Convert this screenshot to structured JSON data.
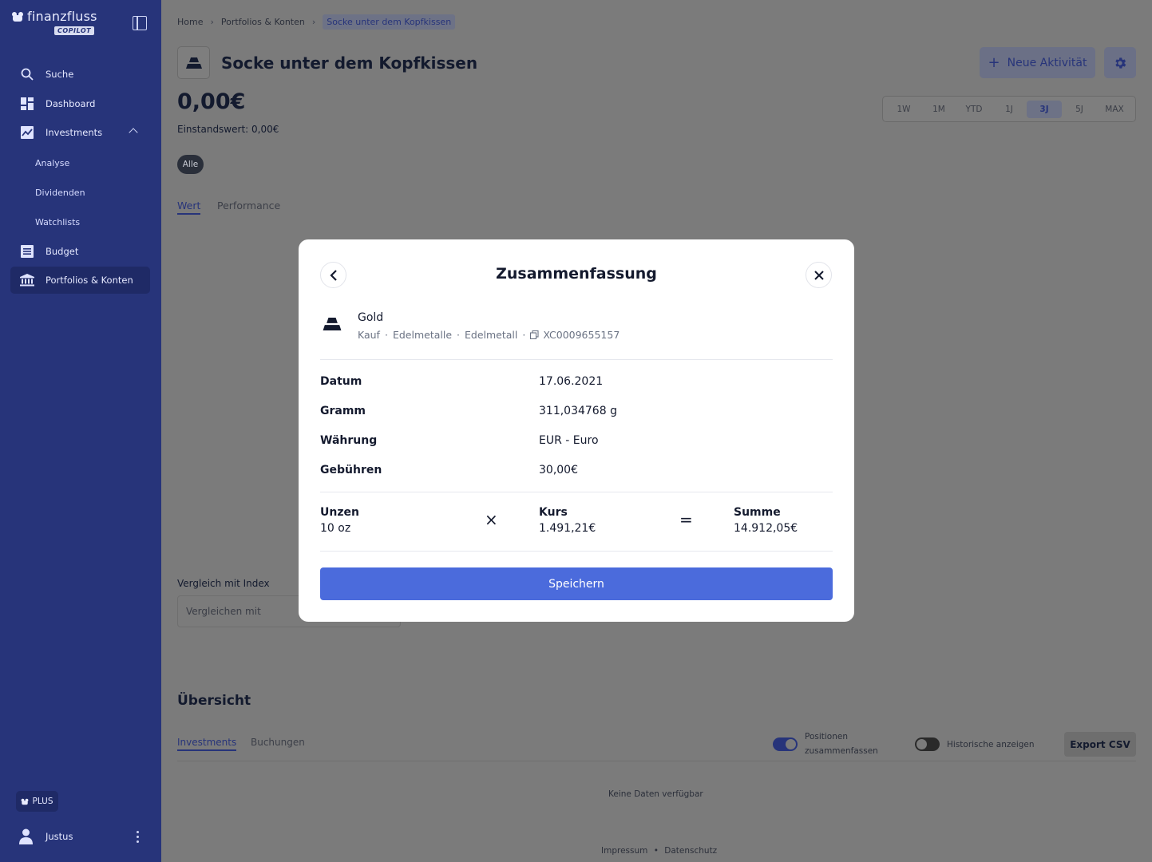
{
  "app": {
    "name": "finanzfluss",
    "sub": "COPILOT"
  },
  "sidebar": {
    "items": [
      {
        "label": "Suche"
      },
      {
        "label": "Dashboard"
      },
      {
        "label": "Investments"
      },
      {
        "label": "Budget"
      },
      {
        "label": "Portfolios & Konten"
      }
    ],
    "sub_items": [
      {
        "label": "Analyse"
      },
      {
        "label": "Dividenden"
      },
      {
        "label": "Watchlists"
      }
    ],
    "plus_label": "PLUS",
    "user_name": "Justus"
  },
  "breadcrumb": [
    "Home",
    "Portfolios & Konten",
    "Socke unter dem Kopfkissen"
  ],
  "page": {
    "title": "Socke unter dem Kopfkissen",
    "value": "0,00€",
    "einstand": "Einstandswert: 0,00€",
    "chip": "Alle",
    "tabs": [
      "Wert",
      "Performance"
    ],
    "new_activity": "Neue Aktivität",
    "ranges": [
      "1W",
      "1M",
      "YTD",
      "1J",
      "3J",
      "5J",
      "MAX"
    ],
    "selected_range": "3J",
    "compare_label": "Vergleich mit Index",
    "compare_placeholder": "Vergleichen mit",
    "overview_title": "Übersicht",
    "overview_tabs": [
      "Investments",
      "Buchungen"
    ],
    "toggle_positions": "Positionen zusammenfassen",
    "toggle_positions_on": true,
    "toggle_history": "Historische anzeigen",
    "toggle_history_on": false,
    "export": "Export CSV",
    "no_data": "Keine Daten verfügbar",
    "footer": {
      "impressum": "Impressum",
      "sep": "•",
      "datenschutz": "Datenschutz"
    }
  },
  "modal": {
    "title": "Zusammenfassung",
    "asset": {
      "name": "Gold",
      "type": "Kauf",
      "category": "Edelmetalle",
      "kind": "Edelmetall",
      "isin": "XC0009655157"
    },
    "rows": [
      {
        "label": "Datum",
        "value": "17.06.2021"
      },
      {
        "label": "Gramm",
        "value": "311,034768 g"
      },
      {
        "label": "Währung",
        "value": "EUR - Euro"
      },
      {
        "label": "Gebühren",
        "value": "30,00€"
      }
    ],
    "calc": {
      "qty_label": "Unzen",
      "qty_value": "10 oz",
      "times": "×",
      "price_label": "Kurs",
      "price_value": "1.491,21€",
      "equals": "=",
      "sum_label": "Summe",
      "sum_value": "14.912,05€"
    },
    "save": "Speichern"
  },
  "colors": {
    "sidebar": "#27347a",
    "primary": "#4b6bdc",
    "text": "#141a2e"
  }
}
